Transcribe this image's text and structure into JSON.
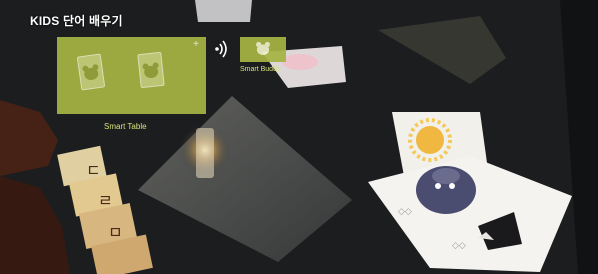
{
  "title": "KIDS 단어 배우기",
  "smart_table": {
    "label": "Smart Table",
    "add_symbol": "+"
  },
  "smart_buddy": {
    "label": "Smart Buddy"
  },
  "icons": {
    "panel_icon": "bear-icon",
    "connection": "wireless-signal-icon"
  },
  "colors": {
    "panel": "#a6b443",
    "label": "#d9e27a",
    "title": "#ffffff"
  }
}
